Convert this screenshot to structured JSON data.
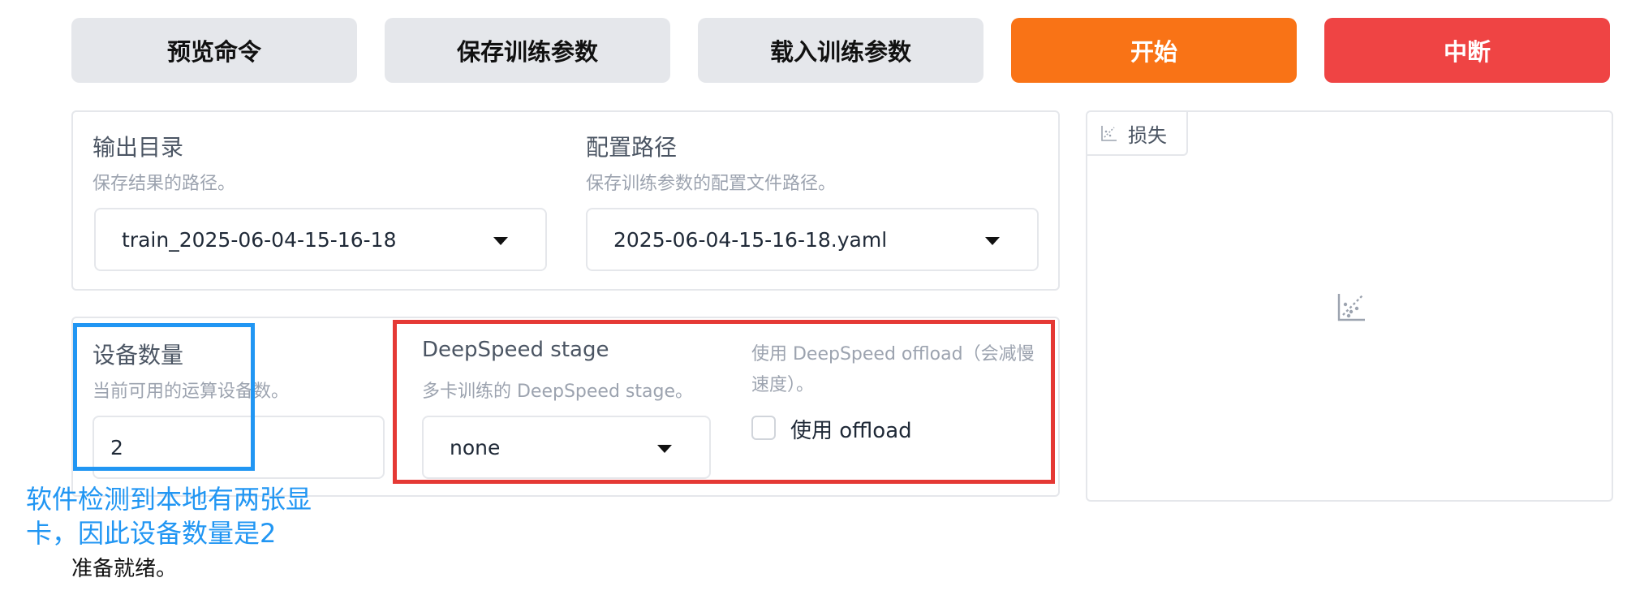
{
  "buttons": {
    "preview": "预览命令",
    "save": "保存训练参数",
    "load": "载入训练参数",
    "start": "开始",
    "abort": "中断"
  },
  "output_panel": {
    "output_dir": {
      "label": "输出目录",
      "info": "保存结果的路径。",
      "value": "train_2025-06-04-15-16-18"
    },
    "config_path": {
      "label": "配置路径",
      "info": "保存训练参数的配置文件路径。",
      "value": "2025-06-04-15-16-18.yaml"
    }
  },
  "device_panel": {
    "device_count": {
      "label": "设备数量",
      "info": "当前可用的运算设备数。",
      "value": "2"
    },
    "ds_stage": {
      "label": "DeepSpeed stage",
      "info": "多卡训练的 DeepSpeed stage。",
      "value": "none"
    },
    "ds_offload": {
      "info_line1": "使用 DeepSpeed offload（会减慢",
      "info_line2": "速度）。",
      "checkbox_label": "使用 offload",
      "checked": false
    }
  },
  "loss_panel": {
    "tab_label": "损失",
    "tab_icon": "chart-icon",
    "placeholder_icon": "scatter-chart-icon"
  },
  "status_text": "准备就绪。",
  "annotation": {
    "line1": "软件检测到本地有两张显",
    "line2": "卡，因此设备数量是2",
    "blue": "#2196f3",
    "red": "#e53935"
  },
  "colors": {
    "start": "#f97316",
    "abort": "#ef4444",
    "neutral_button": "#e5e7eb"
  }
}
